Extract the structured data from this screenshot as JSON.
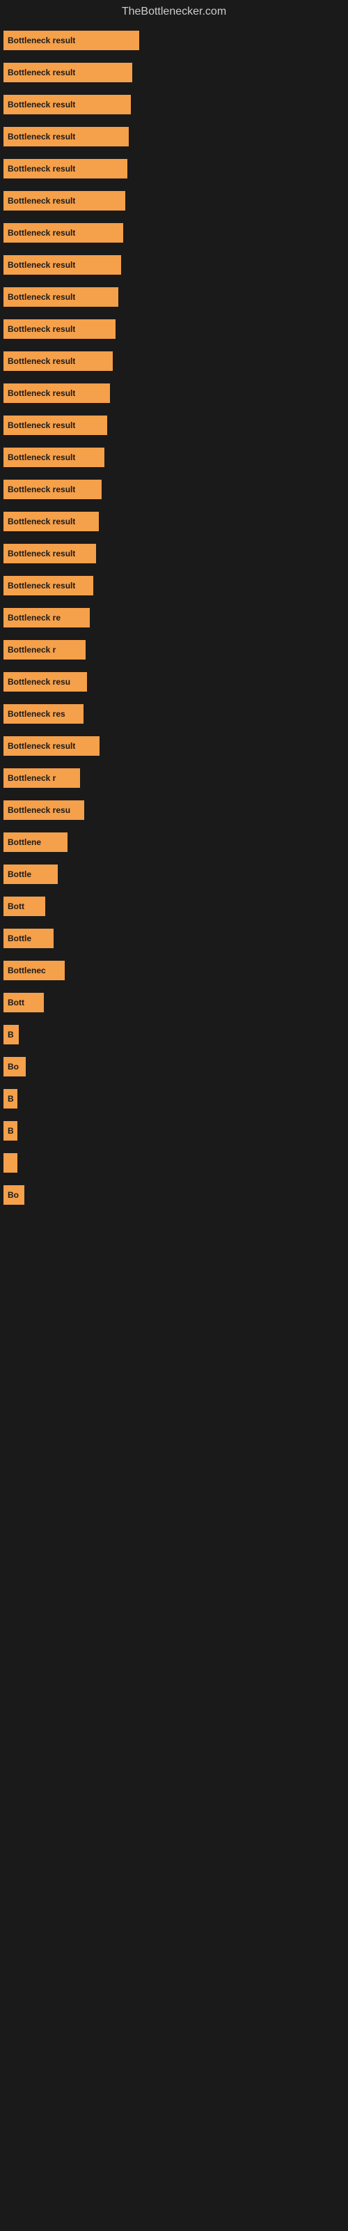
{
  "site": {
    "title": "TheBottlenecker.com"
  },
  "bars": [
    {
      "label": "Bottleneck result",
      "width": 195,
      "id": "bar-1"
    },
    {
      "label": "Bottleneck result",
      "width": 185,
      "id": "bar-2"
    },
    {
      "label": "Bottleneck result",
      "width": 183,
      "id": "bar-3"
    },
    {
      "label": "Bottleneck result",
      "width": 180,
      "id": "bar-4"
    },
    {
      "label": "Bottleneck result",
      "width": 178,
      "id": "bar-5"
    },
    {
      "label": "Bottleneck result",
      "width": 175,
      "id": "bar-6"
    },
    {
      "label": "Bottleneck result",
      "width": 172,
      "id": "bar-7"
    },
    {
      "label": "Bottleneck result",
      "width": 169,
      "id": "bar-8"
    },
    {
      "label": "Bottleneck result",
      "width": 165,
      "id": "bar-9"
    },
    {
      "label": "Bottleneck result",
      "width": 161,
      "id": "bar-10"
    },
    {
      "label": "Bottleneck result",
      "width": 157,
      "id": "bar-11"
    },
    {
      "label": "Bottleneck result",
      "width": 153,
      "id": "bar-12"
    },
    {
      "label": "Bottleneck result",
      "width": 149,
      "id": "bar-13"
    },
    {
      "label": "Bottleneck result",
      "width": 145,
      "id": "bar-14"
    },
    {
      "label": "Bottleneck result",
      "width": 141,
      "id": "bar-15"
    },
    {
      "label": "Bottleneck result",
      "width": 137,
      "id": "bar-16"
    },
    {
      "label": "Bottleneck result",
      "width": 133,
      "id": "bar-17"
    },
    {
      "label": "Bottleneck result",
      "width": 129,
      "id": "bar-18"
    },
    {
      "label": "Bottleneck re",
      "width": 124,
      "id": "bar-19"
    },
    {
      "label": "Bottleneck r",
      "width": 118,
      "id": "bar-20"
    },
    {
      "label": "Bottleneck resu",
      "width": 120,
      "id": "bar-21"
    },
    {
      "label": "Bottleneck res",
      "width": 115,
      "id": "bar-22"
    },
    {
      "label": "Bottleneck result",
      "width": 138,
      "id": "bar-23"
    },
    {
      "label": "Bottleneck r",
      "width": 110,
      "id": "bar-24"
    },
    {
      "label": "Bottleneck resu",
      "width": 116,
      "id": "bar-25"
    },
    {
      "label": "Bottlene",
      "width": 92,
      "id": "bar-26"
    },
    {
      "label": "Bottle",
      "width": 78,
      "id": "bar-27"
    },
    {
      "label": "Bott",
      "width": 60,
      "id": "bar-28"
    },
    {
      "label": "Bottle",
      "width": 72,
      "id": "bar-29"
    },
    {
      "label": "Bottlenec",
      "width": 88,
      "id": "bar-30"
    },
    {
      "label": "Bott",
      "width": 58,
      "id": "bar-31"
    },
    {
      "label": "B",
      "width": 22,
      "id": "bar-32"
    },
    {
      "label": "Bo",
      "width": 32,
      "id": "bar-33"
    },
    {
      "label": "B",
      "width": 18,
      "id": "bar-34"
    },
    {
      "label": "B",
      "width": 16,
      "id": "bar-35"
    },
    {
      "label": "",
      "width": 10,
      "id": "bar-36"
    },
    {
      "label": "Bo",
      "width": 30,
      "id": "bar-37"
    }
  ]
}
